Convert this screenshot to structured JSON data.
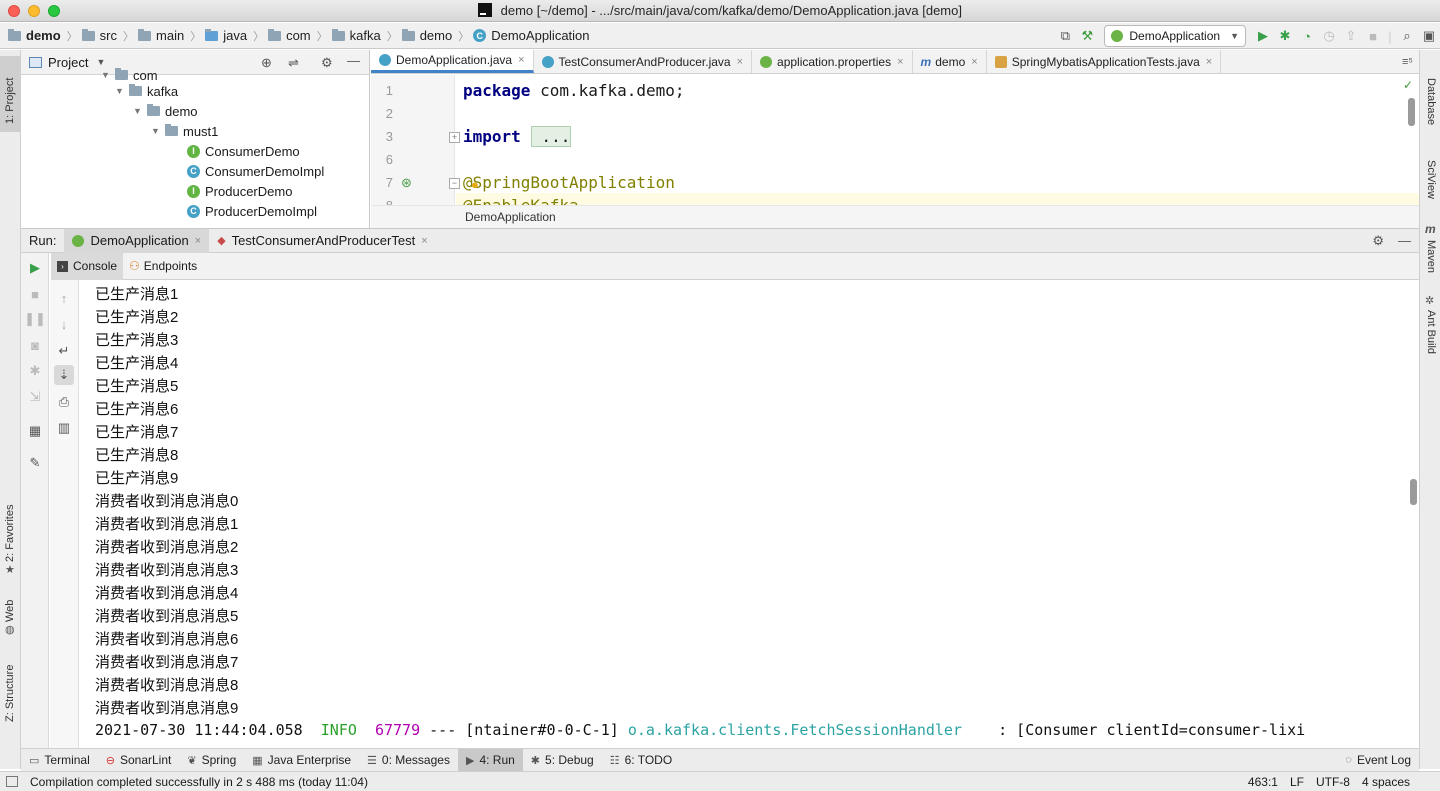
{
  "window": {
    "title": "demo [~/demo] - .../src/main/java/com/kafka/demo/DemoApplication.java [demo]"
  },
  "breadcrumbs": [
    "demo",
    "src",
    "main",
    "java",
    "com",
    "kafka",
    "demo",
    "DemoApplication"
  ],
  "run_config": "DemoApplication",
  "left_tools": {
    "project": "1: Project",
    "favorites": "2: Favorites",
    "web": "Web",
    "structure": "Z: Structure"
  },
  "right_tools": {
    "database": "Database",
    "sciview": "SciView",
    "maven": "Maven",
    "ant": "Ant Build"
  },
  "project_panel": {
    "title": "Project",
    "tree": [
      {
        "label": "com",
        "indent": 0,
        "type": "folder"
      },
      {
        "label": "kafka",
        "indent": 1,
        "type": "folder"
      },
      {
        "label": "demo",
        "indent": 2,
        "type": "folder"
      },
      {
        "label": "must1",
        "indent": 3,
        "type": "folder"
      },
      {
        "label": "ConsumerDemo",
        "indent": 4,
        "type": "interface"
      },
      {
        "label": "ConsumerDemoImpl",
        "indent": 4,
        "type": "class"
      },
      {
        "label": "ProducerDemo",
        "indent": 4,
        "type": "interface"
      },
      {
        "label": "ProducerDemoImpl",
        "indent": 4,
        "type": "class"
      }
    ]
  },
  "editor_tabs": [
    {
      "label": "DemoApplication.java",
      "active": true
    },
    {
      "label": "TestConsumerAndProducer.java",
      "active": false
    },
    {
      "label": "application.properties",
      "active": false
    },
    {
      "label": "demo",
      "active": false
    },
    {
      "label": "SpringMybatisApplicationTests.java",
      "active": false
    }
  ],
  "code": [
    {
      "line": "1",
      "kw": "package",
      "rest": " com.kafka.demo;"
    },
    {
      "line": "2",
      "kw": "",
      "rest": ""
    },
    {
      "line": "3",
      "kw": "import",
      "rest": " ..."
    },
    {
      "line": "6",
      "kw": "",
      "rest": ""
    },
    {
      "line": "7",
      "kw": "",
      "rest": "@SpringBootApplication"
    },
    {
      "line": "8",
      "kw": "",
      "rest": "@EnableKafka"
    }
  ],
  "editor_breadcrumb": "DemoApplication",
  "run_panel": {
    "label": "Run:",
    "tabs": [
      "DemoApplication",
      "TestConsumerAndProducerTest"
    ],
    "console_tabs": [
      "Console",
      "Endpoints"
    ]
  },
  "console_lines": [
    "已生产消息1",
    "已生产消息2",
    "已生产消息3",
    "已生产消息4",
    "已生产消息5",
    "已生产消息6",
    "已生产消息7",
    "已生产消息8",
    "已生产消息9",
    "消费者收到消息消息0",
    "消费者收到消息消息1",
    "消费者收到消息消息2",
    "消费者收到消息消息3",
    "消费者收到消息消息4",
    "消费者收到消息消息5",
    "消费者收到消息消息6",
    "消费者收到消息消息7",
    "消费者收到消息消息8",
    "消费者收到消息消息9"
  ],
  "log_line": {
    "timestamp": "2021-07-30 11:44:04.058",
    "level": "INFO",
    "pid": "67779",
    "sep": "---",
    "thread": "[ntainer#0-0-C-1]",
    "logger": "o.a.kafka.clients.FetchSessionHandler",
    "message": ": [Consumer clientId=consumer-lixi"
  },
  "bottom_tools": [
    "Terminal",
    "SonarLint",
    "Spring",
    "Java Enterprise",
    "0: Messages",
    "4: Run",
    "5: Debug",
    "6: TODO"
  ],
  "event_log": "Event Log",
  "status": {
    "message": "Compilation completed successfully in 2 s 488 ms (today 11:04)",
    "position": "463:1",
    "line_sep": "LF",
    "encoding": "UTF-8",
    "indent": "4 spaces"
  },
  "colors": {
    "keyword": "#000080",
    "annotation": "#808000",
    "info": "#2a9f2a",
    "pid": "#b200b2",
    "logger": "#2ba3a3",
    "accent": "#4083c9"
  }
}
